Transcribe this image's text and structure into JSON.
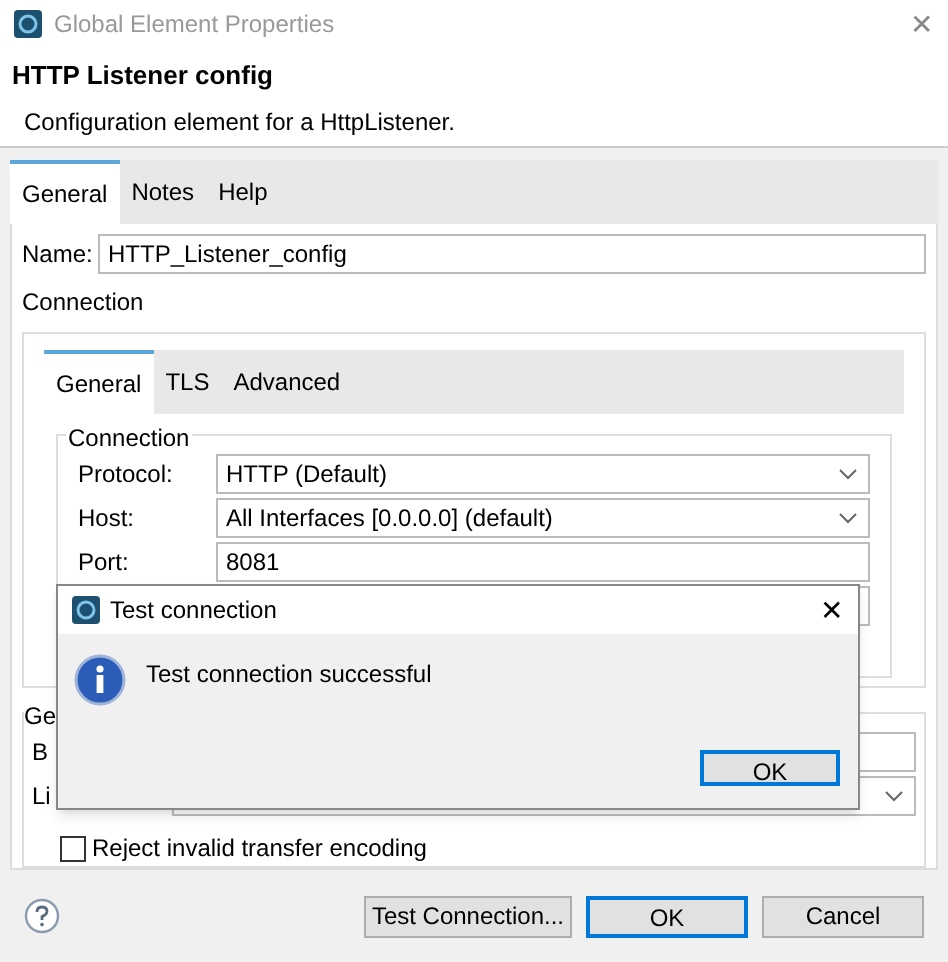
{
  "window": {
    "title": "Global Element Properties",
    "close": "✕"
  },
  "header": {
    "title": "HTTP Listener config",
    "description": "Configuration element for a HttpListener."
  },
  "tabs": [
    {
      "label": "General",
      "selected": true
    },
    {
      "label": "Notes",
      "selected": false
    },
    {
      "label": "Help",
      "selected": false
    }
  ],
  "name_field": {
    "label": "Name:",
    "value": "HTTP_Listener_config"
  },
  "connection_label": "Connection",
  "connection_tabs": [
    {
      "label": "General",
      "selected": true
    },
    {
      "label": "TLS",
      "selected": false
    },
    {
      "label": "Advanced",
      "selected": false
    }
  ],
  "connection_group": {
    "legend": "Connection",
    "fields": [
      {
        "kind": "select",
        "label": "Protocol:",
        "value": "HTTP (Default)"
      },
      {
        "kind": "select",
        "label": "Host:",
        "value": "All Interfaces [0.0.0.0] (default)"
      },
      {
        "kind": "text",
        "label": "Port:",
        "value": "8081"
      },
      {
        "kind": "text"
      }
    ]
  },
  "general_group": {
    "legend": "Ge",
    "fields": [
      {
        "kind": "text",
        "label": "B"
      },
      {
        "kind": "select",
        "label": "Li"
      }
    ],
    "checkbox": {
      "label": "Reject invalid transfer encoding",
      "checked": false
    }
  },
  "footer": {
    "buttons": [
      {
        "label": "Test Connection...",
        "default": false
      },
      {
        "label": "OK",
        "default": true
      },
      {
        "label": "Cancel",
        "default": false
      }
    ]
  },
  "dialog": {
    "title": "Test connection",
    "close": "✕",
    "message": "Test connection successful",
    "button": "OK"
  }
}
